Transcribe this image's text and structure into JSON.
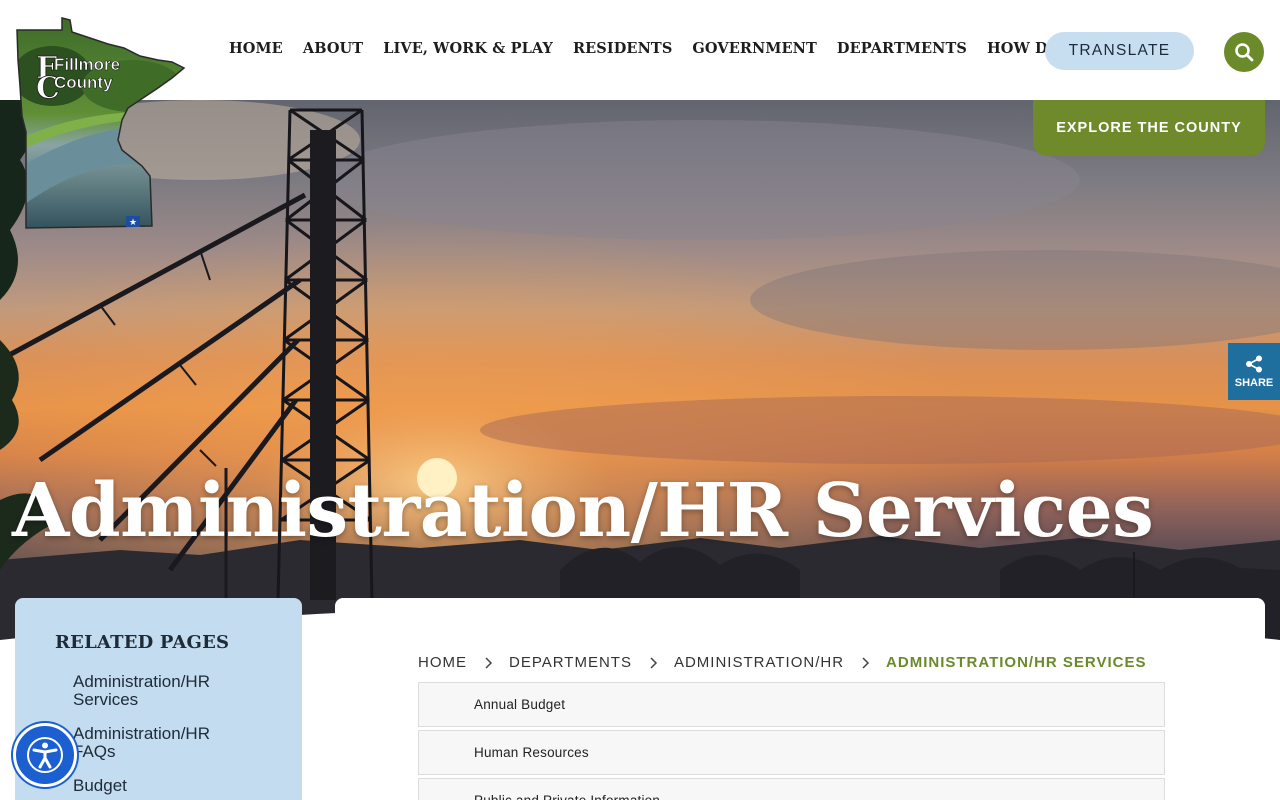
{
  "header": {
    "logo_text_line1": "Fillmore",
    "logo_text_line2": "County",
    "nav": [
      {
        "label": "HOME"
      },
      {
        "label": "ABOUT"
      },
      {
        "label": "LIVE, WORK & PLAY"
      },
      {
        "label": "RESIDENTS"
      },
      {
        "label": "GOVERNMENT"
      },
      {
        "label": "DEPARTMENTS"
      },
      {
        "label": "HOW DO I"
      }
    ],
    "translate_label": "TRANSLATE",
    "search_icon": "search-icon"
  },
  "hero": {
    "explore_label": "EXPLORE THE COUNTY",
    "title": "Administration/HR Services"
  },
  "share": {
    "label": "SHARE",
    "icon": "share-icon"
  },
  "sidebar": {
    "title": "RELATED PAGES",
    "links": [
      {
        "label": "Administration/HR Services"
      },
      {
        "label": "Administration/HR FAQs"
      },
      {
        "label": "Budget"
      }
    ]
  },
  "breadcrumb": {
    "items": [
      {
        "label": "HOME"
      },
      {
        "label": "DEPARTMENTS"
      },
      {
        "label": "ADMINISTRATION/HR"
      },
      {
        "label": "ADMINISTRATION/HR SERVICES"
      }
    ]
  },
  "documents": {
    "items": [
      {
        "label": "Annual Budget"
      },
      {
        "label": "Human Resources"
      },
      {
        "label": "Public and Private Information"
      }
    ]
  },
  "colors": {
    "accent_green": "#6b8a2a",
    "light_blue": "#c6def0",
    "share_blue": "#1e6e9e",
    "a11y_blue": "#1b5fd1"
  }
}
